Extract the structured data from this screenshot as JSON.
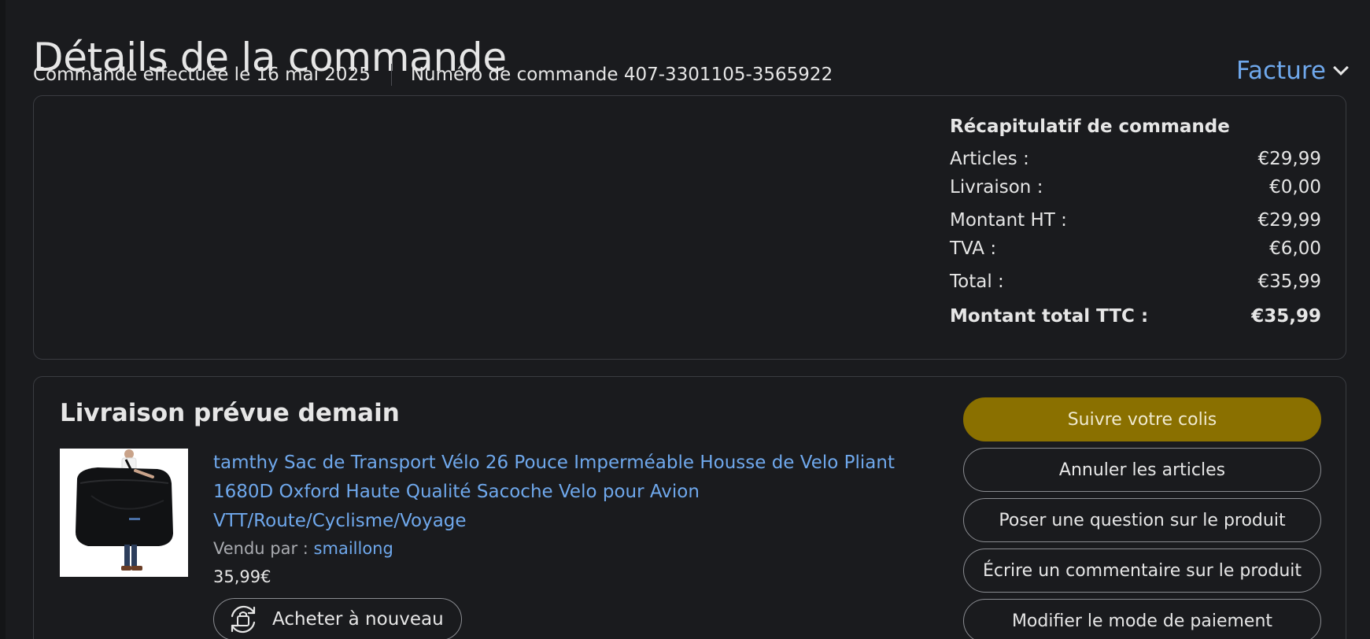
{
  "page": {
    "title": "Détails de la commande",
    "order_date": "Commande effectuée le 16 mai 2025",
    "order_number": "Numéro de commande 407-3301105-3565922",
    "invoice_label": "Facture"
  },
  "summary": {
    "title": "Récapitulatif de commande",
    "rows": [
      {
        "label": "Articles :",
        "value": "€29,99"
      },
      {
        "label": "Livraison :",
        "value": "€0,00"
      },
      {
        "label": "Montant HT :",
        "value": "€29,99"
      },
      {
        "label": "TVA :",
        "value": "€6,00"
      },
      {
        "label": "Total :",
        "value": "€35,99"
      },
      {
        "label": "Montant total TTC :",
        "value": "€35,99"
      }
    ]
  },
  "delivery": {
    "title": "Livraison prévue demain",
    "product": {
      "title": "tamthy Sac de Transport Vélo 26 Pouce Imperméable Housse de Velo Pliant 1680D Oxford Haute Qualité Sacoche Velo pour Avion VTT/Route/Cyclisme/Voyage",
      "seller_prefix": "Vendu par  : ",
      "seller": "smaillong",
      "price": "35,99€",
      "buy_again_label": "Acheter à nouveau"
    },
    "actions": [
      "Suivre votre colis",
      "Annuler les articles",
      "Poser une question sur le produit",
      "Écrire un commentaire sur le produit",
      "Modifier le mode de paiement"
    ]
  },
  "colors": {
    "background": "#1a1b1e",
    "link": "#6fa8ec",
    "primary_button": "#8a7000",
    "border": "#3a3c41"
  },
  "icons": [
    "chevron-down-icon",
    "buy-again-icon"
  ]
}
